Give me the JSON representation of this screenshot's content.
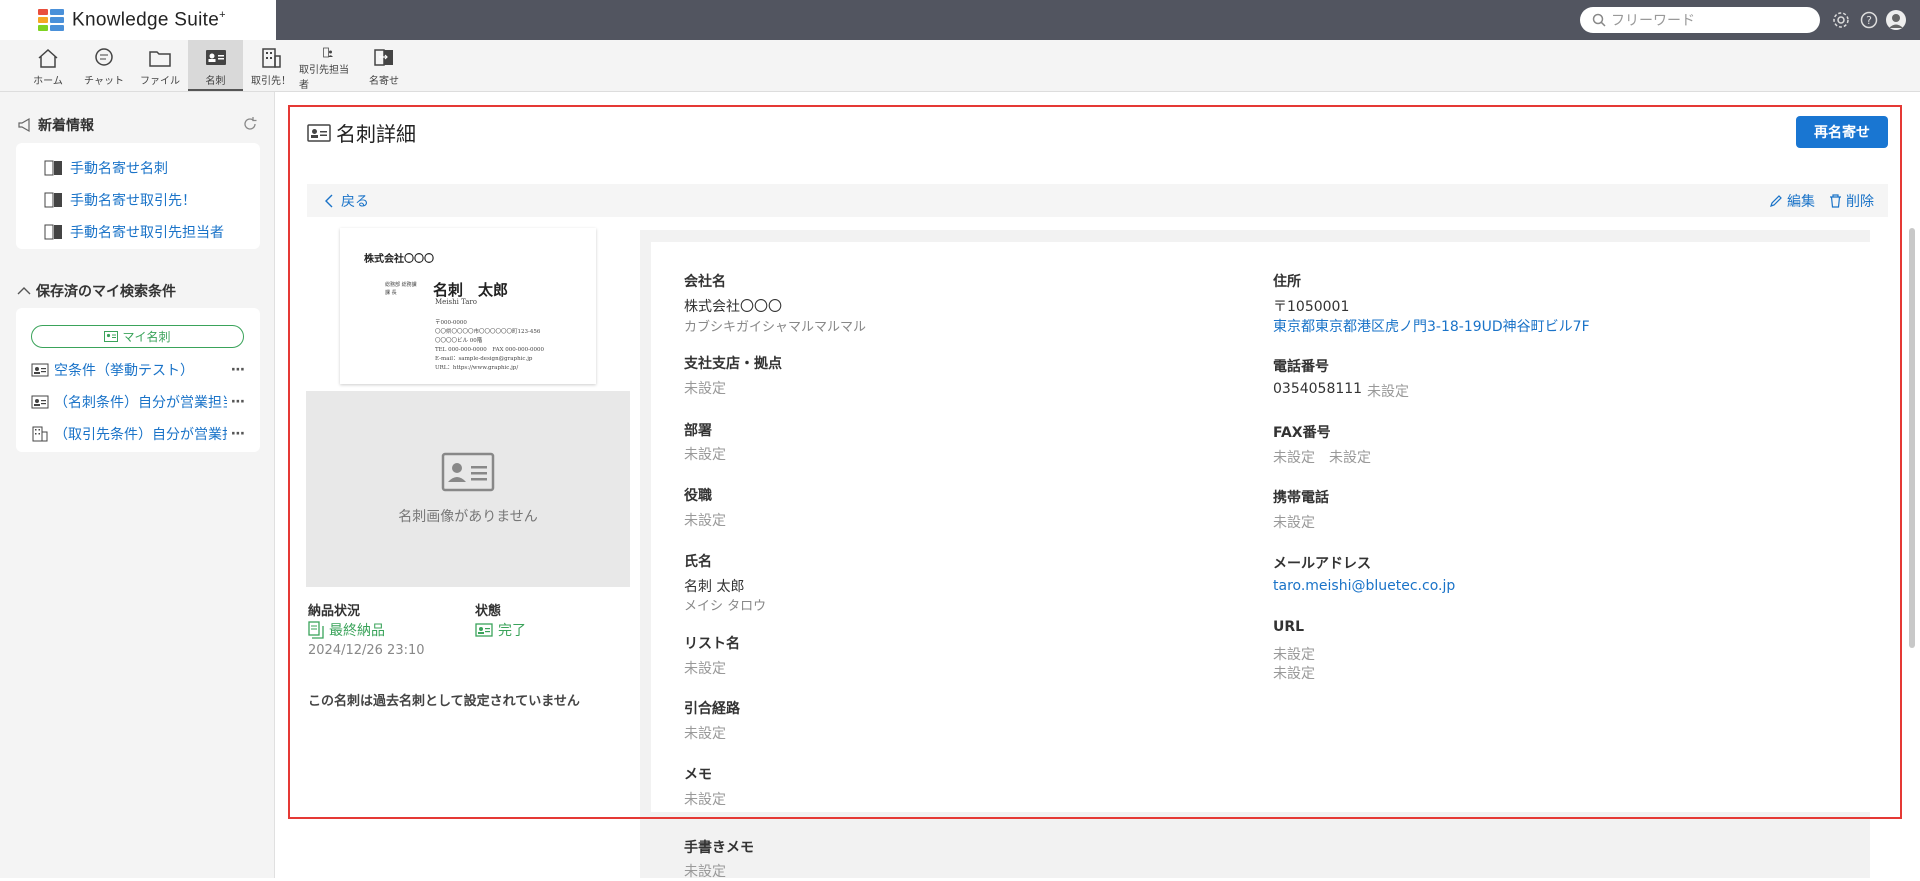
{
  "app": {
    "name": "Knowledge Suite",
    "name_sup": "+"
  },
  "header": {
    "search_placeholder": "フリーワード"
  },
  "tabs": [
    {
      "label": "ホーム",
      "icon": "home-icon"
    },
    {
      "label": "チャット",
      "icon": "chat-icon"
    },
    {
      "label": "ファイル",
      "icon": "folder-icon"
    },
    {
      "label": "名刺",
      "icon": "business-card-icon",
      "active": true
    },
    {
      "label": "取引先！",
      "icon": "building-icon"
    },
    {
      "label": "取引先担当者",
      "icon": "contact-person-icon"
    },
    {
      "label": "名寄せ",
      "icon": "merge-icon"
    }
  ],
  "sidebar": {
    "news_title": "新着情報",
    "news_items": [
      "手動名寄せ名刺",
      "手動名寄せ取引先！",
      "手動名寄せ取引先担当者"
    ],
    "saved_title": "保存済のマイ検索条件",
    "my_card_label": "マイ名刺",
    "conditions": [
      {
        "label": "空条件（挙動テスト）",
        "icon": "business-card-icon"
      },
      {
        "label": "（名刺条件）自分が営業担当",
        "icon": "business-card-icon"
      },
      {
        "label": "（取引先条件）自分が営業担当",
        "icon": "building-icon"
      }
    ]
  },
  "page": {
    "title": "名刺詳細",
    "rematch_button": "再名寄せ",
    "back": "戻る",
    "edit": "編集",
    "delete": "削除"
  },
  "card_image": {
    "company": "株式会社〇〇〇",
    "dept": "総務部 総務課",
    "role": "課 長",
    "name": "名刺　太郎",
    "romaji": "Meishi Taro",
    "lines": [
      "〒000-0000",
      "〇〇県〇〇〇〇市〇〇〇〇〇〇町123-456",
      "〇〇〇〇ビル 00階",
      "TEL 000-000-0000　FAX 000-000-0000",
      "E-mail：sample-design@graphic.jp",
      "URL：https://www.graphic.jp/"
    ],
    "no_image_text": "名刺画像がありません"
  },
  "status": {
    "delivery_label": "納品状況",
    "delivery_value": "最終納品",
    "delivery_date": "2024/12/26 23:10",
    "state_label": "状態",
    "state_value": "完了",
    "past_note": "この名刺は過去名刺として設定されていません"
  },
  "fields_left": {
    "company_label": "会社名",
    "company_value": "株式会社〇〇〇",
    "company_kana": "カブシキガイシャマルマルマル",
    "branch_label": "支社支店・拠点",
    "branch_value": "未設定",
    "dept_label": "部署",
    "dept_value": "未設定",
    "position_label": "役職",
    "position_value": "未設定",
    "name_label": "氏名",
    "name_value": "名刺 太郎",
    "name_kana": "メイシ タロウ",
    "list_label": "リスト名",
    "list_value": "未設定",
    "route_label": "引合経路",
    "route_value": "未設定",
    "memo_label": "メモ",
    "memo_value": "未設定",
    "hand_memo_label": "手書きメモ",
    "hand_memo_value": "未設定"
  },
  "fields_right": {
    "address_label": "住所",
    "zip": "〒1050001",
    "address": "東京都東京都港区虎ノ門3-18-19UD神谷町ビル7F",
    "tel_label": "電話番号",
    "tel_value": "0354058111",
    "tel_ext": "未設定",
    "fax_label": "FAX番号",
    "fax_value": "未設定",
    "fax_ext": "未設定",
    "mobile_label": "携帯電話",
    "mobile_value": "未設定",
    "mail_label": "メールアドレス",
    "mail_value": "taro.meishi@bluetec.co.jp",
    "url_label": "URL",
    "url_value1": "未設定",
    "url_value2": "未設定"
  },
  "colors": {
    "accent": "#1976d2",
    "link": "#1a73c8",
    "success": "#3aa35a",
    "frame": "#e53935"
  }
}
